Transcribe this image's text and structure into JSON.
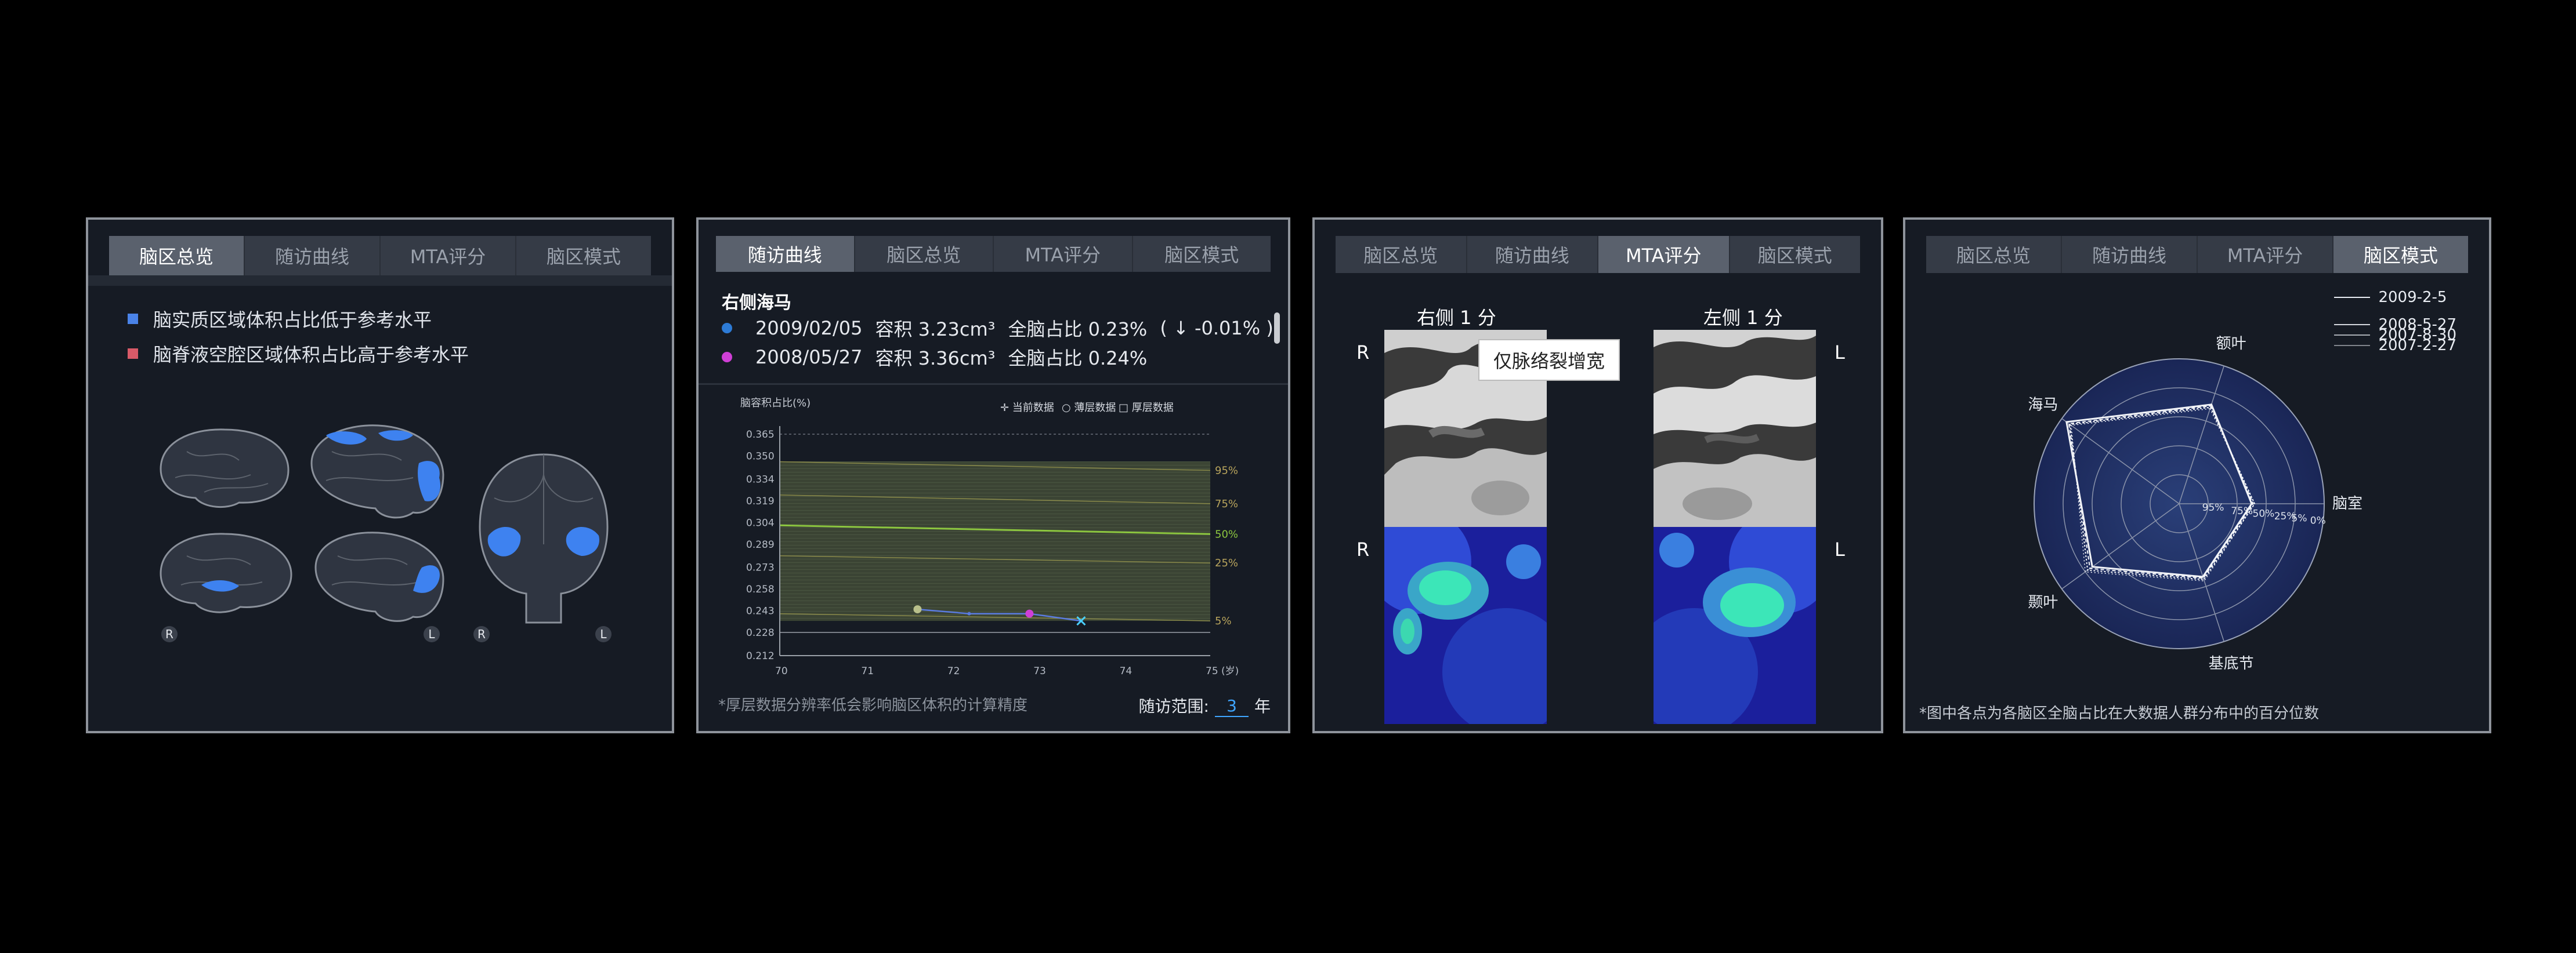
{
  "panels": {
    "overview": {
      "tabs": [
        "脑区总览",
        "随访曲线",
        "MTA评分",
        "脑区模式"
      ],
      "legend": [
        {
          "label": "脑实质区域体积占比低于参考水平",
          "color": "#4a83e8"
        },
        {
          "label": "脑脊液空腔区域体积占比高于参考水平",
          "color": "#d85a68"
        }
      ],
      "markers": [
        "R",
        "L",
        "R",
        "L"
      ]
    },
    "followup": {
      "tabs": [
        "随访曲线",
        "脑区总览",
        "MTA评分",
        "脑区模式"
      ],
      "region_title": "右侧海马",
      "records": [
        {
          "date": "2009/02/05",
          "volume": "容积 3.23cm³",
          "ratio": "全脑占比 0.23%",
          "delta": "( ↓ -0.01% )",
          "dot_color": "#2d7bd6"
        },
        {
          "date": "2008/05/27",
          "volume": "容积 3.36cm³",
          "ratio": "全脑占比 0.24%",
          "delta": "",
          "dot_color": "#cf3fd6"
        }
      ],
      "footnote": "*厚层数据分辨率低会影响脑区体积的计算精度",
      "range_label": "随访范围:",
      "range_value": "3",
      "range_unit": "年"
    },
    "mta": {
      "tabs": [
        "脑区总览",
        "随访曲线",
        "MTA评分",
        "脑区模式"
      ],
      "right_score": "右侧 1 分",
      "left_score": "左侧 1 分",
      "side_labels": [
        "R",
        "L",
        "R",
        "L"
      ],
      "tooltip": "仅脉络裂增宽"
    },
    "pattern": {
      "tabs": [
        "脑区总览",
        "随访曲线",
        "MTA评分",
        "脑区模式"
      ],
      "legend": [
        "2009-2-5",
        "2008-5-27",
        "2007-8-30",
        "2007-2-27"
      ],
      "footnote": "*图中各点为各脑区全脑占比在大数据人群分布中的百分位数"
    }
  },
  "chart_data": [
    {
      "type": "line",
      "title": "",
      "ylabel": "脑容积占比(%)",
      "xlabel": "",
      "x_unit": "(岁)",
      "legend": [
        "当前数据",
        "薄层数据",
        "厚层数据"
      ],
      "xlim": [
        70,
        75
      ],
      "ylim": [
        0.212,
        0.365
      ],
      "x_ticks": [
        70,
        71,
        72,
        73,
        74,
        75
      ],
      "y_ticks": [
        0.212,
        0.228,
        0.243,
        0.258,
        0.273,
        0.289,
        0.304,
        0.319,
        0.334,
        0.35,
        0.365
      ],
      "percentile_bands": [
        {
          "label": "95%",
          "start": 0.346,
          "end": 0.34
        },
        {
          "label": "75%",
          "start": 0.323,
          "end": 0.317
        },
        {
          "label": "50%",
          "start": 0.302,
          "end": 0.296
        },
        {
          "label": "25%",
          "start": 0.281,
          "end": 0.276
        },
        {
          "label": "5%",
          "start": 0.241,
          "end": 0.236
        }
      ],
      "series": [
        {
          "points": [
            [
              71.6,
              0.244
            ],
            [
              72.2,
              0.241
            ],
            [
              72.9,
              0.241
            ],
            [
              73.5,
              0.236
            ]
          ]
        }
      ]
    },
    {
      "type": "radar",
      "axes": [
        "额叶",
        "脑室",
        "基底节",
        "颞叶",
        "海马"
      ],
      "ring_labels": [
        "95%",
        "75%",
        "50%",
        "25%",
        "5%",
        "0%"
      ],
      "series": [
        {
          "name": "2009-2-5",
          "values": [
            0.72,
            0.5,
            0.53,
            0.74,
            0.96
          ]
        },
        {
          "name": "2008-5-27",
          "values": [
            0.71,
            0.51,
            0.54,
            0.76,
            0.94
          ]
        },
        {
          "name": "2007-8-30",
          "values": [
            0.7,
            0.52,
            0.55,
            0.78,
            0.93
          ]
        },
        {
          "name": "2007-2-27",
          "values": [
            0.69,
            0.52,
            0.56,
            0.8,
            0.92
          ]
        }
      ]
    }
  ]
}
